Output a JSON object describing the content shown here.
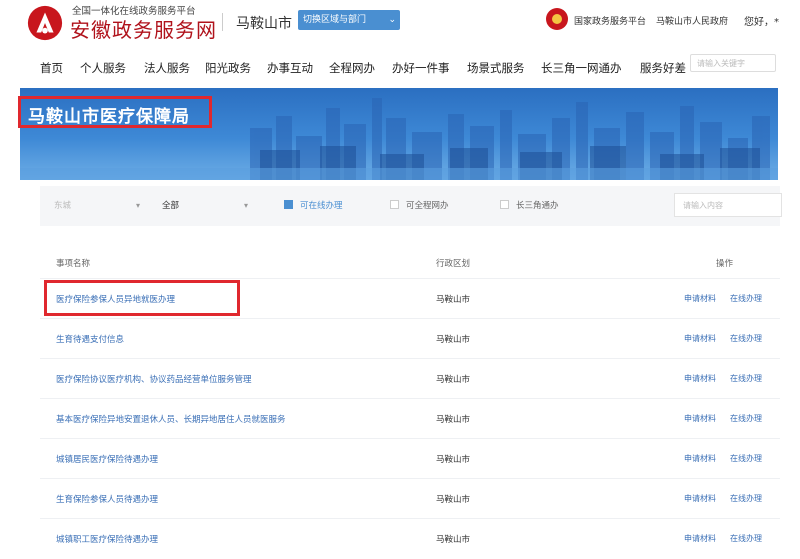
{
  "header": {
    "platform_label": "全国一体化在线政务服务平台",
    "site_name": "安徽政务服务网",
    "city": "马鞍山市",
    "switch_button": "切换区域与部门",
    "national_platform": "国家政务服务平台",
    "city_gov": "马鞍山市人民政府",
    "greeting": "您好，*"
  },
  "nav": {
    "items": [
      "首页",
      "个人服务",
      "法人服务",
      "阳光政务",
      "办事互动",
      "全程网办",
      "办好一件事",
      "场景式服务",
      "长三角一网通办",
      "服务好差"
    ],
    "search_placeholder": "请输入关键字"
  },
  "banner": {
    "title": "马鞍山市医疗保障局"
  },
  "filters": {
    "region_select": "东城",
    "dept_select": "全部",
    "options": [
      {
        "label": "可在线办理",
        "checked": true
      },
      {
        "label": "可全程网办",
        "checked": false
      },
      {
        "label": "长三角通办",
        "checked": false
      }
    ],
    "search_placeholder": "请输入内容"
  },
  "table": {
    "headers": [
      "事项名称",
      "行政区划",
      "操作"
    ],
    "op_labels": [
      "申请材料",
      "在线办理"
    ],
    "rows": [
      {
        "name": "医疗保险参保人员异地就医办理",
        "region": "马鞍山市"
      },
      {
        "name": "生育待遇支付信息",
        "region": "马鞍山市"
      },
      {
        "name": "医疗保险协议医疗机构、协议药品经营单位服务管理",
        "region": "马鞍山市"
      },
      {
        "name": "基本医疗保险异地安置退休人员、长期异地居住人员就医服务",
        "region": "马鞍山市"
      },
      {
        "name": "城镇居民医疗保险待遇办理",
        "region": "马鞍山市"
      },
      {
        "name": "生育保险参保人员待遇办理",
        "region": "马鞍山市"
      },
      {
        "name": "城镇职工医疗保险待遇办理",
        "region": "马鞍山市"
      }
    ]
  },
  "colors": {
    "brand_red": "#b0121b",
    "highlight_red": "#e0282e",
    "link_blue": "#3a6fb6",
    "banner_blue": "#2b6fc1"
  }
}
